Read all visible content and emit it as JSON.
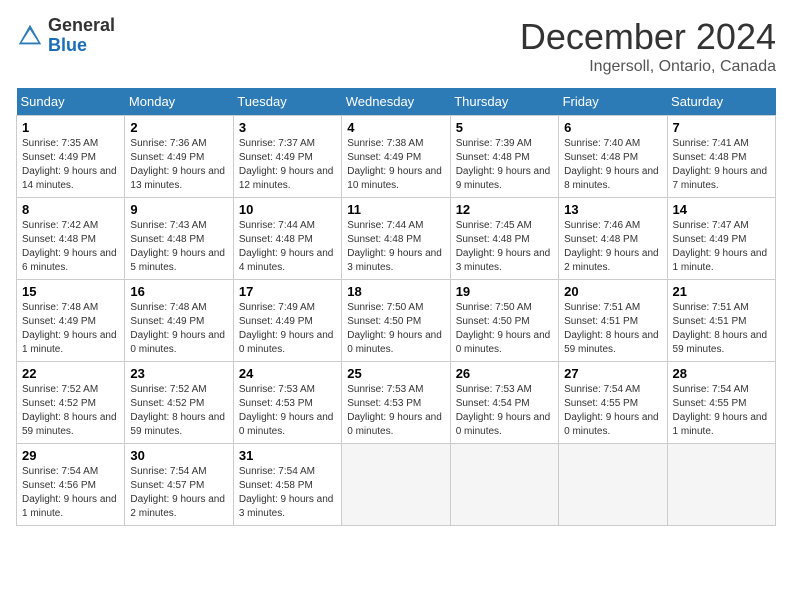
{
  "header": {
    "logo_general": "General",
    "logo_blue": "Blue",
    "month_title": "December 2024",
    "location": "Ingersoll, Ontario, Canada"
  },
  "calendar": {
    "headers": [
      "Sunday",
      "Monday",
      "Tuesday",
      "Wednesday",
      "Thursday",
      "Friday",
      "Saturday"
    ],
    "rows": [
      [
        {
          "day": "1",
          "sunrise": "7:35 AM",
          "sunset": "4:49 PM",
          "daylight": "9 hours and 14 minutes."
        },
        {
          "day": "2",
          "sunrise": "7:36 AM",
          "sunset": "4:49 PM",
          "daylight": "9 hours and 13 minutes."
        },
        {
          "day": "3",
          "sunrise": "7:37 AM",
          "sunset": "4:49 PM",
          "daylight": "9 hours and 12 minutes."
        },
        {
          "day": "4",
          "sunrise": "7:38 AM",
          "sunset": "4:49 PM",
          "daylight": "9 hours and 10 minutes."
        },
        {
          "day": "5",
          "sunrise": "7:39 AM",
          "sunset": "4:48 PM",
          "daylight": "9 hours and 9 minutes."
        },
        {
          "day": "6",
          "sunrise": "7:40 AM",
          "sunset": "4:48 PM",
          "daylight": "9 hours and 8 minutes."
        },
        {
          "day": "7",
          "sunrise": "7:41 AM",
          "sunset": "4:48 PM",
          "daylight": "9 hours and 7 minutes."
        }
      ],
      [
        {
          "day": "8",
          "sunrise": "7:42 AM",
          "sunset": "4:48 PM",
          "daylight": "9 hours and 6 minutes."
        },
        {
          "day": "9",
          "sunrise": "7:43 AM",
          "sunset": "4:48 PM",
          "daylight": "9 hours and 5 minutes."
        },
        {
          "day": "10",
          "sunrise": "7:44 AM",
          "sunset": "4:48 PM",
          "daylight": "9 hours and 4 minutes."
        },
        {
          "day": "11",
          "sunrise": "7:44 AM",
          "sunset": "4:48 PM",
          "daylight": "9 hours and 3 minutes."
        },
        {
          "day": "12",
          "sunrise": "7:45 AM",
          "sunset": "4:48 PM",
          "daylight": "9 hours and 3 minutes."
        },
        {
          "day": "13",
          "sunrise": "7:46 AM",
          "sunset": "4:48 PM",
          "daylight": "9 hours and 2 minutes."
        },
        {
          "day": "14",
          "sunrise": "7:47 AM",
          "sunset": "4:49 PM",
          "daylight": "9 hours and 1 minute."
        }
      ],
      [
        {
          "day": "15",
          "sunrise": "7:48 AM",
          "sunset": "4:49 PM",
          "daylight": "9 hours and 1 minute."
        },
        {
          "day": "16",
          "sunrise": "7:48 AM",
          "sunset": "4:49 PM",
          "daylight": "9 hours and 0 minutes."
        },
        {
          "day": "17",
          "sunrise": "7:49 AM",
          "sunset": "4:49 PM",
          "daylight": "9 hours and 0 minutes."
        },
        {
          "day": "18",
          "sunrise": "7:50 AM",
          "sunset": "4:50 PM",
          "daylight": "9 hours and 0 minutes."
        },
        {
          "day": "19",
          "sunrise": "7:50 AM",
          "sunset": "4:50 PM",
          "daylight": "9 hours and 0 minutes."
        },
        {
          "day": "20",
          "sunrise": "7:51 AM",
          "sunset": "4:51 PM",
          "daylight": "8 hours and 59 minutes."
        },
        {
          "day": "21",
          "sunrise": "7:51 AM",
          "sunset": "4:51 PM",
          "daylight": "8 hours and 59 minutes."
        }
      ],
      [
        {
          "day": "22",
          "sunrise": "7:52 AM",
          "sunset": "4:52 PM",
          "daylight": "8 hours and 59 minutes."
        },
        {
          "day": "23",
          "sunrise": "7:52 AM",
          "sunset": "4:52 PM",
          "daylight": "8 hours and 59 minutes."
        },
        {
          "day": "24",
          "sunrise": "7:53 AM",
          "sunset": "4:53 PM",
          "daylight": "9 hours and 0 minutes."
        },
        {
          "day": "25",
          "sunrise": "7:53 AM",
          "sunset": "4:53 PM",
          "daylight": "9 hours and 0 minutes."
        },
        {
          "day": "26",
          "sunrise": "7:53 AM",
          "sunset": "4:54 PM",
          "daylight": "9 hours and 0 minutes."
        },
        {
          "day": "27",
          "sunrise": "7:54 AM",
          "sunset": "4:55 PM",
          "daylight": "9 hours and 0 minutes."
        },
        {
          "day": "28",
          "sunrise": "7:54 AM",
          "sunset": "4:55 PM",
          "daylight": "9 hours and 1 minute."
        }
      ],
      [
        {
          "day": "29",
          "sunrise": "7:54 AM",
          "sunset": "4:56 PM",
          "daylight": "9 hours and 1 minute."
        },
        {
          "day": "30",
          "sunrise": "7:54 AM",
          "sunset": "4:57 PM",
          "daylight": "9 hours and 2 minutes."
        },
        {
          "day": "31",
          "sunrise": "7:54 AM",
          "sunset": "4:58 PM",
          "daylight": "9 hours and 3 minutes."
        },
        null,
        null,
        null,
        null
      ]
    ]
  }
}
